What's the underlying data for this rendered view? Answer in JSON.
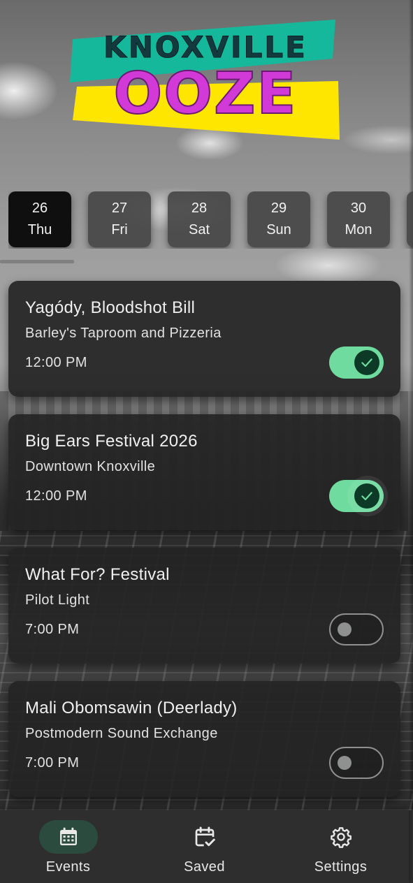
{
  "logo": {
    "line1": "KNOXVILLE",
    "line2": "OOZE"
  },
  "dates": [
    {
      "day": "26",
      "weekday": "Thu",
      "active": true
    },
    {
      "day": "27",
      "weekday": "Fri",
      "active": false
    },
    {
      "day": "28",
      "weekday": "Sat",
      "active": false
    },
    {
      "day": "29",
      "weekday": "Sun",
      "active": false
    },
    {
      "day": "30",
      "weekday": "Mon",
      "active": false
    }
  ],
  "events": [
    {
      "title": "Yagódy, Bloodshot Bill",
      "venue": "Barley's Taproom and Pizzeria",
      "time": "12:00 PM",
      "saved": true
    },
    {
      "title": "Big Ears Festival 2026",
      "venue": "Downtown Knoxville",
      "time": "12:00 PM",
      "saved": true
    },
    {
      "title": "What For? Festival",
      "venue": "Pilot Light",
      "time": "7:00 PM",
      "saved": false
    },
    {
      "title": "Mali Obomsawin (Deerlady)",
      "venue": "Postmodern Sound Exchange",
      "time": "7:00 PM",
      "saved": false
    }
  ],
  "nav": {
    "events_label": "Events",
    "saved_label": "Saved",
    "settings_label": "Settings"
  },
  "colors": {
    "toggle_on": "#6fdb9f",
    "toggle_knob_on": "#0c3a26",
    "nav_active_pill": "#2a4b3d",
    "logo_teal": "#15b89a",
    "logo_yellow": "#ffe600",
    "logo_magenta": "#d23ad8"
  }
}
